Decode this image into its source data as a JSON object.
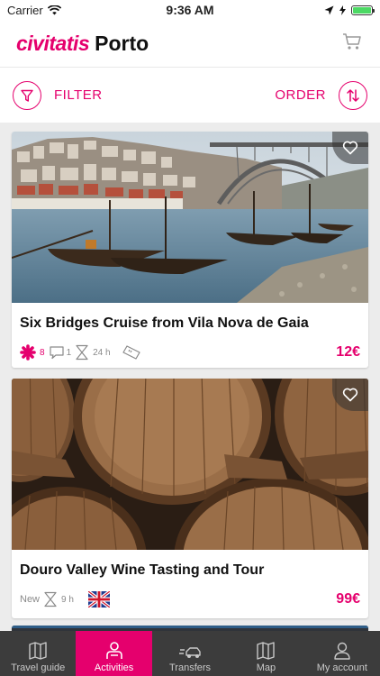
{
  "status": {
    "carrier": "Carrier",
    "time": "9:36 AM"
  },
  "header": {
    "brand": "civitatis",
    "city": "Porto"
  },
  "toolbar": {
    "filter_label": "FILTER",
    "order_label": "ORDER"
  },
  "activities": [
    {
      "title": "Six Bridges Cruise from Vila Nova de Gaia",
      "rating_count": "8",
      "duration": "24 h",
      "price": "12€"
    },
    {
      "title": "Douro Valley Wine Tasting and Tour",
      "badge": "New",
      "duration": "9 h",
      "price": "99€"
    }
  ],
  "tabs": [
    {
      "label": "Travel guide",
      "icon": "map-book-icon",
      "active": false
    },
    {
      "label": "Activities",
      "icon": "person-icon",
      "active": true
    },
    {
      "label": "Transfers",
      "icon": "car-icon",
      "active": false
    },
    {
      "label": "Map",
      "icon": "map-icon",
      "active": false
    },
    {
      "label": "My account",
      "icon": "user-icon",
      "active": false
    }
  ],
  "colors": {
    "accent": "#e5006d",
    "tabbar": "#3c3c3c"
  }
}
